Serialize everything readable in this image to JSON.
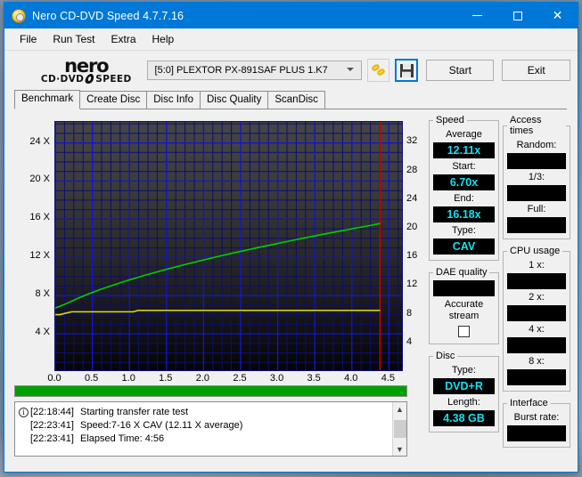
{
  "window": {
    "title": "Nero CD-DVD Speed 4.7.7.16",
    "icon": "nero-disc-icon",
    "minimize_label": "Minimize",
    "maximize_label": "Maximize",
    "close_label": "Close"
  },
  "menu": {
    "items": [
      "File",
      "Run Test",
      "Extra",
      "Help"
    ]
  },
  "toolbar": {
    "logo_word": "nero",
    "logo_sub_left": "CD·DVD",
    "logo_sub_right": "SPEED",
    "drive_value": "[5:0]   PLEXTOR PX-891SAF PLUS 1.K7",
    "drive_placeholder": "Select drive",
    "chain_icon": "chain-link-icon",
    "save_icon": "floppy-save-icon",
    "start_label": "Start",
    "exit_label": "Exit"
  },
  "tabs": [
    {
      "label": "Benchmark",
      "active": true
    },
    {
      "label": "Create Disc",
      "active": false
    },
    {
      "label": "Disc Info",
      "active": false
    },
    {
      "label": "Disc Quality",
      "active": false
    },
    {
      "label": "ScanDisc",
      "active": false
    }
  ],
  "panels": {
    "speed": {
      "legend": "Speed",
      "average_label": "Average",
      "average_value": "12.11x",
      "start_label": "Start:",
      "start_value": "6.70x",
      "end_label": "End:",
      "end_value": "16.18x",
      "type_label": "Type:",
      "type_value": "CAV"
    },
    "dae": {
      "legend": "DAE quality",
      "quality_value": "",
      "accurate_line1": "Accurate",
      "accurate_line2": "stream",
      "accurate_checked": false
    },
    "disc": {
      "legend": "Disc",
      "type_label": "Type:",
      "type_value": "DVD+R",
      "length_label": "Length:",
      "length_value": "4.38 GB"
    },
    "access_times": {
      "legend": "Access times",
      "random_label": "Random:",
      "random_value": "",
      "third_label": "1/3:",
      "third_value": "",
      "full_label": "Full:",
      "full_value": ""
    },
    "cpu_usage": {
      "legend": "CPU usage",
      "x1_label": "1 x:",
      "x1_value": "",
      "x2_label": "2 x:",
      "x2_value": "",
      "x4_label": "4 x:",
      "x4_value": "",
      "x8_label": "8 x:",
      "x8_value": ""
    },
    "interface": {
      "legend": "Interface",
      "burst_label": "Burst rate:",
      "burst_value": ""
    }
  },
  "progress": {
    "percent": 100,
    "color": "#00a000"
  },
  "log": {
    "entries": [
      {
        "icon": "info-icon",
        "time": "[22:18:44]",
        "text": "Starting transfer rate test"
      },
      {
        "icon": "",
        "time": "[22:23:41]",
        "text": "Speed:7-16 X CAV (12.11 X average)"
      },
      {
        "icon": "",
        "time": "[22:23:41]",
        "text": "Elapsed Time:  4:56"
      }
    ],
    "scroll_up": "▲",
    "scroll_down": "▼"
  },
  "chart_data": {
    "type": "line",
    "title": "",
    "xlabel": "",
    "ylabel": "",
    "xlim": [
      0,
      4.7
    ],
    "ylim_left": [
      0,
      26.2
    ],
    "ylim_right": [
      0,
      34.9
    ],
    "x_ticks": [
      "0.0",
      "0.5",
      "1.0",
      "1.5",
      "2.0",
      "2.5",
      "3.0",
      "3.5",
      "4.0",
      "4.5"
    ],
    "x_tick_values": [
      0.0,
      0.5,
      1.0,
      1.5,
      2.0,
      2.5,
      3.0,
      3.5,
      4.0,
      4.5
    ],
    "y_ticks_left": [
      "24 X",
      "20 X",
      "16 X",
      "12 X",
      "8 X",
      "4 X"
    ],
    "y_tick_values_left": [
      24,
      20,
      16,
      12,
      8,
      4
    ],
    "y_ticks_right": [
      "32",
      "28",
      "24",
      "20",
      "16",
      "12",
      "8",
      "4"
    ],
    "y_tick_values_right": [
      32,
      28,
      24,
      20,
      16,
      12,
      8,
      4
    ],
    "grid": true,
    "grid_color": "#1414d2",
    "background_top": "#454545",
    "background_bottom": "#050505",
    "series": [
      {
        "name": "transfer rate",
        "color": "#00d000",
        "axis": "left",
        "x": [
          0.0,
          0.1,
          0.2,
          0.3,
          0.45,
          0.6,
          0.8,
          1.0,
          1.25,
          1.5,
          1.75,
          2.0,
          2.25,
          2.5,
          2.75,
          3.0,
          3.25,
          3.5,
          3.75,
          4.0,
          4.25,
          4.38
        ],
        "values": [
          6.7,
          7.0,
          7.35,
          7.7,
          8.18,
          8.62,
          9.15,
          9.65,
          10.22,
          10.76,
          11.26,
          11.74,
          12.2,
          12.64,
          13.06,
          13.47,
          13.87,
          14.26,
          14.63,
          15.0,
          15.35,
          15.55
        ]
      },
      {
        "name": "cpu / dae line",
        "color": "#e0e000",
        "axis": "right",
        "x": [
          0.0,
          0.06,
          0.22,
          1.05,
          1.12,
          4.38
        ],
        "values": [
          8.0,
          8.0,
          8.4,
          8.4,
          8.6,
          8.6
        ]
      }
    ],
    "markers": [
      {
        "name": "end-of-disc",
        "type": "vline",
        "x": 4.38,
        "color": "#d00000"
      }
    ]
  }
}
